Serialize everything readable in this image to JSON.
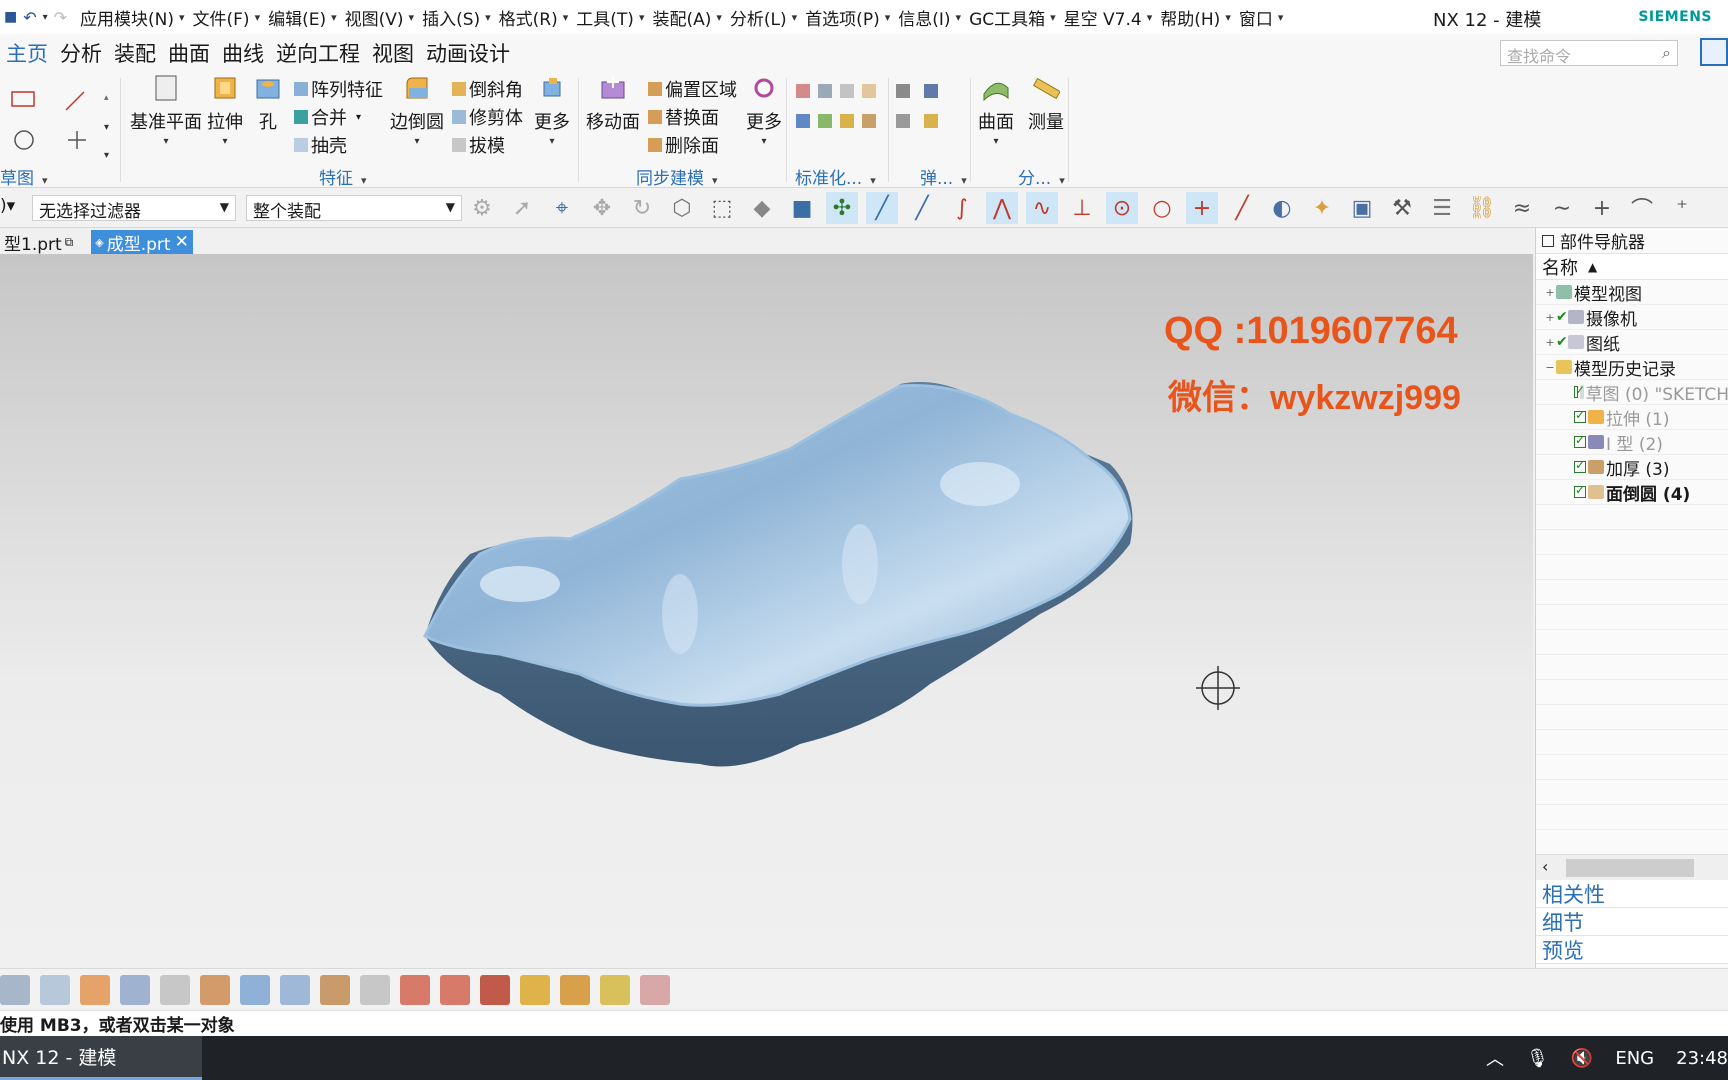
{
  "titlebar": {
    "menus": [
      "应用模块(N)",
      "文件(F)",
      "编辑(E)",
      "视图(V)",
      "插入(S)",
      "格式(R)",
      "工具(T)",
      "装配(A)",
      "分析(L)",
      "首选项(P)",
      "信息(I)",
      "GC工具箱",
      "星空 V7.4",
      "帮助(H)",
      "窗口"
    ],
    "app_title": "NX 12 - 建模",
    "brand": "SIEMENS"
  },
  "ribbon_tabs": [
    "主页",
    "分析",
    "装配",
    "曲面",
    "曲线",
    "逆向工程",
    "视图",
    "动画设计"
  ],
  "search": {
    "placeholder": "查找命令"
  },
  "ribbon": {
    "groups": {
      "sketch": "草图",
      "feature": "特征",
      "sync": "同步建模",
      "standard": "标准化...",
      "spring": "弹...",
      "analysis": "分..."
    },
    "commands": {
      "datum_plane": "基准平面",
      "extrude": "拉伸",
      "hole": "孔",
      "pattern_feature": "阵列特征",
      "unite": "合并",
      "shell": "抽壳",
      "edge_blend": "边倒圆",
      "chamfer": "倒斜角",
      "trim_body": "修剪体",
      "draft": "拔模",
      "more1": "更多",
      "move_face": "移动面",
      "offset_region": "偏置区域",
      "replace_face": "替换面",
      "delete_face": "删除面",
      "more2": "更多",
      "surface": "曲面",
      "measure": "测量"
    }
  },
  "selection_bar": {
    "filter": "无选择过滤器",
    "scope": "整个装配"
  },
  "file_tabs": [
    {
      "label": "型1.prt"
    },
    {
      "label": "成型.prt"
    }
  ],
  "viewport": {
    "watermark_qq": "QQ :1019607764",
    "watermark_wx": "微信：wykzwzj999"
  },
  "navigator": {
    "title": "部件导航器",
    "column": "名称",
    "items": [
      {
        "label": "模型视图"
      },
      {
        "label": "摄像机"
      },
      {
        "label": "图纸"
      },
      {
        "label": "模型历史记录"
      },
      {
        "label": "草图 (0) \"SKETCH"
      },
      {
        "label": "拉伸 (1)"
      },
      {
        "label": "I 型 (2)"
      },
      {
        "label": "加厚 (3)"
      },
      {
        "label": "面倒圆 (4)"
      }
    ],
    "links": [
      "相关性",
      "细节",
      "预览"
    ]
  },
  "status_text": "使用 MB3，或者双击某一对象",
  "taskbar": {
    "app": "NX 12 - 建模",
    "lang": "ENG",
    "time": "23:48"
  }
}
